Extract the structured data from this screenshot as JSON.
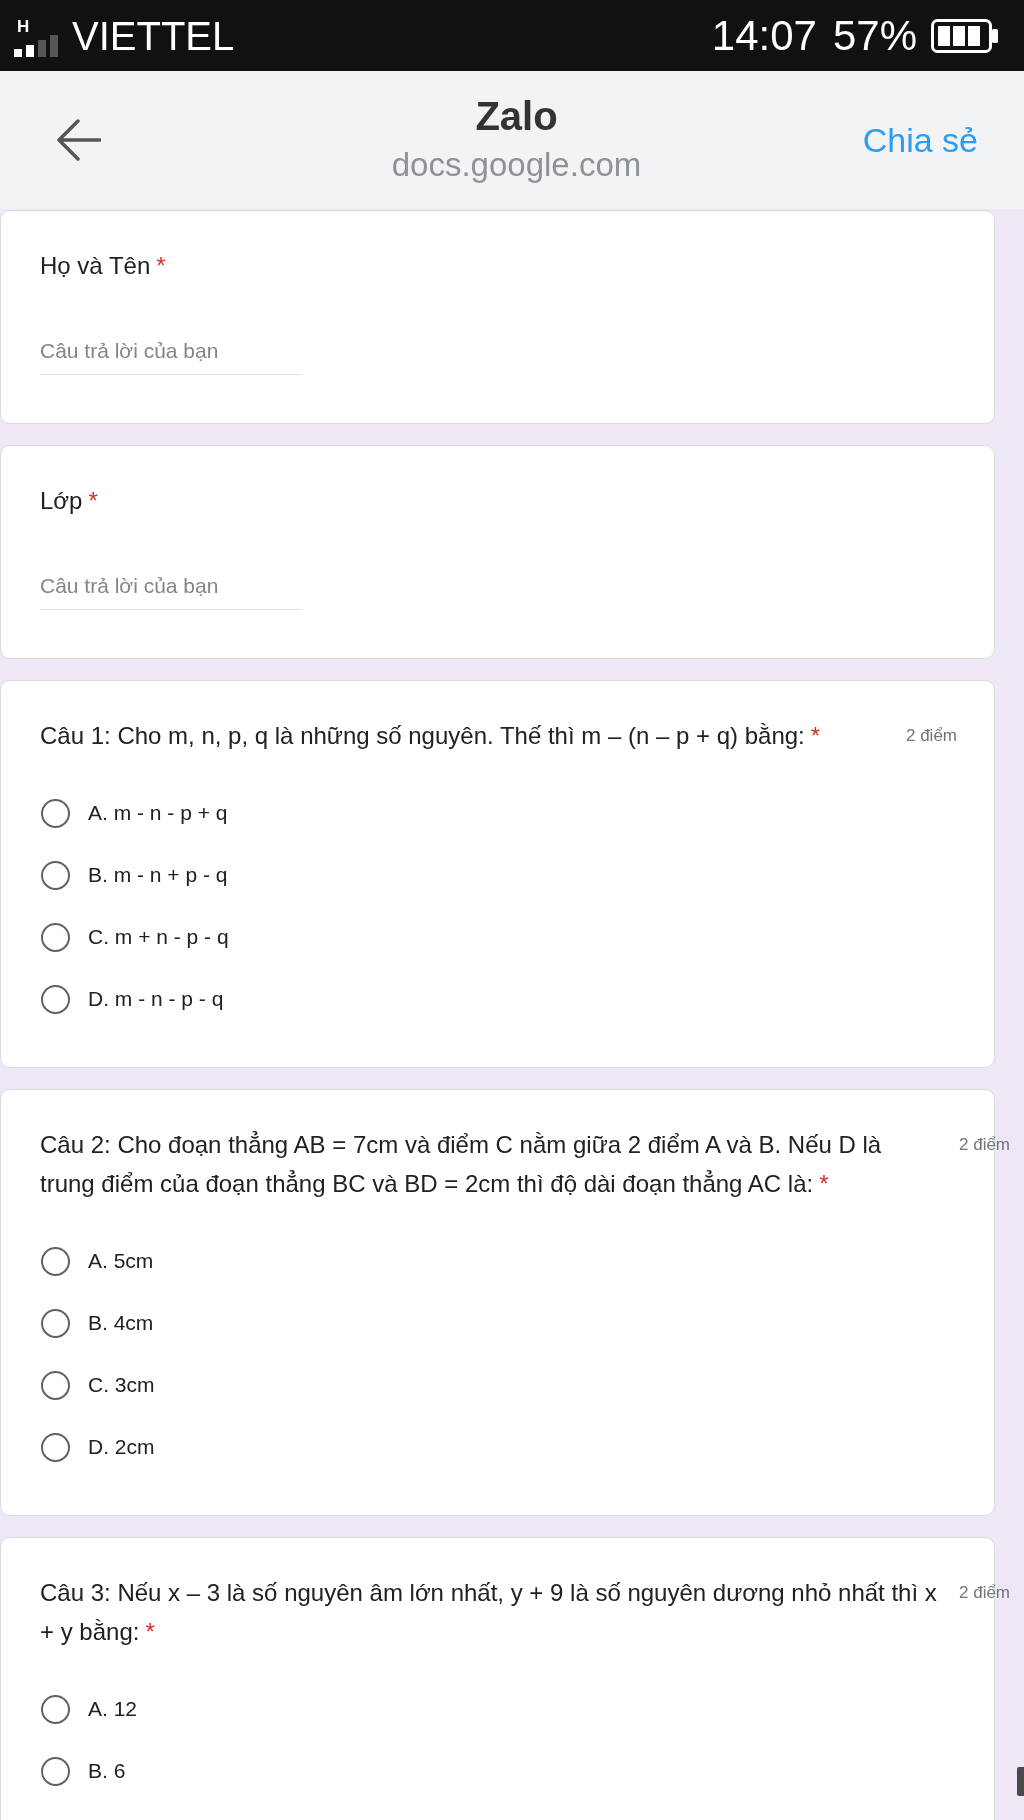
{
  "status_bar": {
    "network_type": "H",
    "carrier": "VIETTEL",
    "time": "14:07",
    "battery": "57%"
  },
  "header": {
    "title": "Zalo",
    "subtitle": "docs.google.com",
    "action": "Chia sẻ"
  },
  "form": {
    "items": [
      {
        "kind": "text",
        "title": "Họ và Tên",
        "required_mark": "*",
        "placeholder": "Câu trả lời của bạn"
      },
      {
        "kind": "text",
        "title": "Lớp",
        "required_mark": "*",
        "placeholder": "Câu trả lời của bạn"
      },
      {
        "kind": "choice",
        "title": "Câu 1: Cho m, n, p, q là những số nguyên. Thế thì m – (n – p + q) bằng:",
        "required_mark": "*",
        "points": "2 điểm",
        "options": [
          {
            "label": "A. m - n - p + q",
            "selected": false
          },
          {
            "label": "B. m - n + p - q",
            "selected": false
          },
          {
            "label": "C. m + n - p - q",
            "selected": false
          },
          {
            "label": "D. m - n - p - q",
            "selected": false
          }
        ]
      },
      {
        "kind": "choice",
        "title": "Câu 2: Cho đoạn thẳng AB = 7cm và điểm C nằm giữa 2 điểm A và B. Nếu D là trung điểm của đoạn thẳng BC và BD = 2cm thì độ dài đoạn thẳng AC là:",
        "required_mark": "*",
        "points": "2 điểm",
        "options": [
          {
            "label": "A. 5cm",
            "selected": false
          },
          {
            "label": "B. 4cm",
            "selected": false
          },
          {
            "label": "C. 3cm",
            "selected": false
          },
          {
            "label": "D. 2cm",
            "selected": false
          }
        ]
      },
      {
        "kind": "choice",
        "title": "Câu 3: Nếu x – 3 là số nguyên âm lớn nhất, y + 9 là số nguyên dương nhỏ nhất thì x + y bằng:",
        "required_mark": "*",
        "points": "2 điểm",
        "options": [
          {
            "label": "A. 12",
            "selected": false
          },
          {
            "label": "B. 6",
            "selected": false
          }
        ]
      }
    ]
  }
}
